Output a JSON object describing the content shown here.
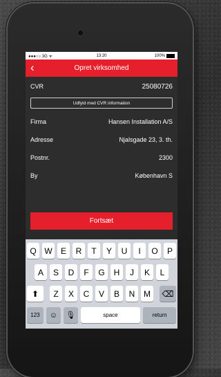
{
  "status": {
    "left": "●●●○○ 3G ᯤ",
    "time": "13:20",
    "battery": "100%"
  },
  "nav": {
    "back_glyph": "‹",
    "title": "Opret virksomhed"
  },
  "form": {
    "cvr_label": "CVR",
    "cvr_value": "25080726",
    "fill_button": "Udfyld med CVR information",
    "rows": [
      {
        "label": "Firma",
        "value": "Hansen Installation A/S"
      },
      {
        "label": "Adresse",
        "value": "Njalsgade 23, 3. th."
      },
      {
        "label": "Postnr.",
        "value": "2300"
      },
      {
        "label": "By",
        "value": "København S"
      }
    ],
    "continue_button": "Fortsæt"
  },
  "keyboard": {
    "row1": [
      "Q",
      "W",
      "E",
      "R",
      "T",
      "Y",
      "U",
      "I",
      "O",
      "P"
    ],
    "row2": [
      "A",
      "S",
      "D",
      "F",
      "G",
      "H",
      "J",
      "K",
      "L"
    ],
    "row3": [
      "Z",
      "X",
      "C",
      "V",
      "B",
      "N",
      "M"
    ],
    "shift_glyph": "⬆",
    "delete_glyph": "⌫",
    "numbers_label": "123",
    "emoji_glyph": "☺",
    "mic_glyph": "🎙",
    "space_label": "space",
    "return_label": "return"
  }
}
